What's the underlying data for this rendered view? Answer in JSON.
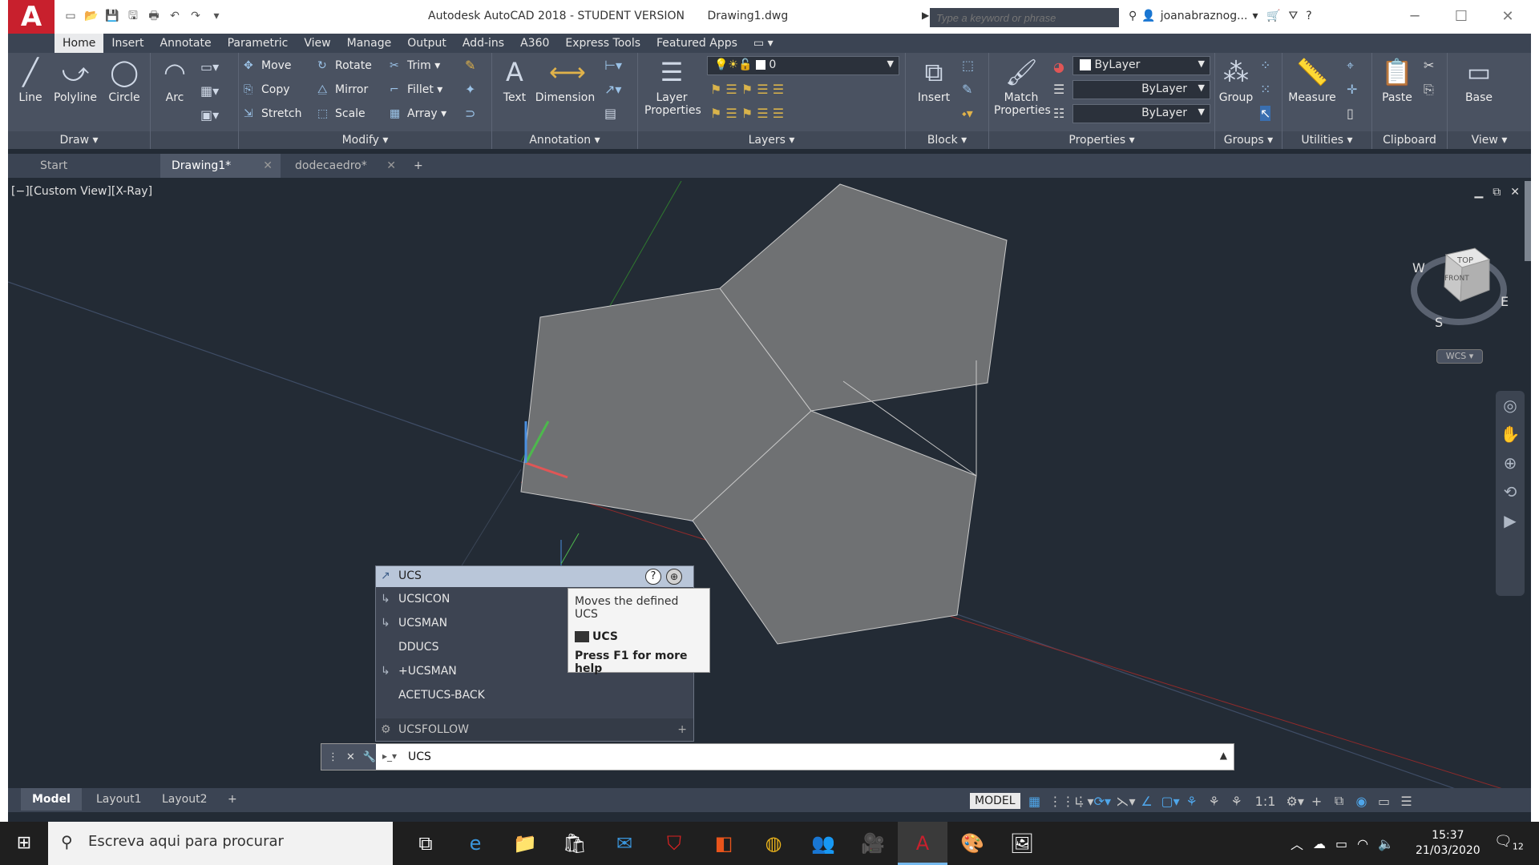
{
  "titlebar": {
    "app_title": "Autodesk AutoCAD 2018 - STUDENT VERSION",
    "file_name": "Drawing1.dwg",
    "search_placeholder": "Type a keyword or phrase",
    "user": "joanabraznog...",
    "logo": "A"
  },
  "ribbon_tabs": [
    "Home",
    "Insert",
    "Annotate",
    "Parametric",
    "View",
    "Manage",
    "Output",
    "Add-ins",
    "A360",
    "Express Tools",
    "Featured Apps"
  ],
  "ribbon": {
    "draw": {
      "title": "Draw",
      "line": "Line",
      "polyline": "Polyline",
      "circle": "Circle",
      "arc": "Arc"
    },
    "modify": {
      "title": "Modify",
      "move": "Move",
      "rotate": "Rotate",
      "trim": "Trim",
      "copy": "Copy",
      "mirror": "Mirror",
      "fillet": "Fillet",
      "stretch": "Stretch",
      "scale": "Scale",
      "array": "Array"
    },
    "annotation": {
      "title": "Annotation",
      "text": "Text",
      "dimension": "Dimension"
    },
    "layers": {
      "title": "Layers",
      "layer_properties_1": "Layer",
      "layer_properties_2": "Properties",
      "current_layer": "0"
    },
    "block": {
      "title": "Block",
      "insert": "Insert"
    },
    "properties": {
      "title": "Properties",
      "match_1": "Match",
      "match_2": "Properties",
      "color": "ByLayer",
      "linetype": "ByLayer",
      "lineweight": "ByLayer"
    },
    "groups": {
      "title": "Groups",
      "group": "Group"
    },
    "utilities": {
      "title": "Utilities",
      "measure": "Measure"
    },
    "clipboard": {
      "title": "Clipboard",
      "paste": "Paste"
    },
    "view": {
      "title": "View",
      "base": "Base"
    }
  },
  "file_tabs": [
    {
      "label": "Start"
    },
    {
      "label": "Drawing1*"
    },
    {
      "label": "dodecaedro*"
    }
  ],
  "viewport": {
    "label": "[−][Custom View][X-Ray]",
    "viewcube": {
      "top": "TOP",
      "front": "FRONT",
      "n_w": "W",
      "n_s": "S",
      "n_e": "E",
      "wcs": "WCS"
    }
  },
  "autocomplete": {
    "header": "UCS",
    "items": [
      "UCSICON",
      "UCSMAN",
      "DDUCS",
      "+UCSMAN",
      "ACETUCS-BACK"
    ],
    "footer": "UCSFOLLOW"
  },
  "tooltip": {
    "description": "Moves the defined UCS",
    "command": "UCS",
    "help": "Press F1 for more help"
  },
  "command_line": {
    "value": "UCS"
  },
  "layout_tabs": [
    "Model",
    "Layout1",
    "Layout2"
  ],
  "status": {
    "model": "MODEL",
    "scale": "1:1"
  },
  "taskbar": {
    "search_placeholder": "Escreva aqui para procurar",
    "time": "15:37",
    "date": "21/03/2020",
    "notifications": "12"
  }
}
